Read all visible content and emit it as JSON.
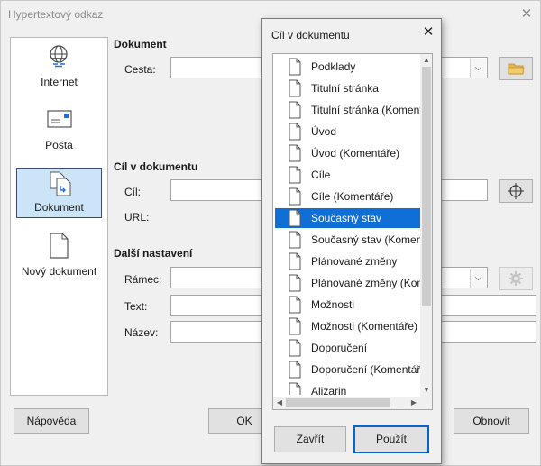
{
  "main": {
    "title": "Hypertextový odkaz",
    "close": "✕",
    "sidebar": {
      "items": [
        {
          "label": "Internet"
        },
        {
          "label": "Pošta"
        },
        {
          "label": "Dokument"
        },
        {
          "label": "Nový dokument"
        }
      ]
    },
    "document_section": {
      "heading": "Dokument",
      "path_label": "Cesta:",
      "path_value": ""
    },
    "target_section": {
      "heading": "Cíl v dokumentu",
      "target_label": "Cíl:",
      "target_value": "",
      "url_label": "URL:"
    },
    "other_section": {
      "heading": "Další nastavení",
      "frame_label": "Rámec:",
      "text_label": "Text:",
      "name_label": "Název:"
    },
    "buttons": {
      "help": "Nápověda",
      "ok": "OK",
      "reset": "Obnovit"
    }
  },
  "popup": {
    "title": "Cíl v dokumentu",
    "close": "✕",
    "items": [
      {
        "label": "Podklady"
      },
      {
        "label": "Titulní stránka"
      },
      {
        "label": "Titulní stránka (Komentáře)"
      },
      {
        "label": "Úvod"
      },
      {
        "label": "Úvod (Komentáře)"
      },
      {
        "label": "Cíle"
      },
      {
        "label": "Cíle (Komentáře)"
      },
      {
        "label": "Současný stav"
      },
      {
        "label": "Současný stav (Komentáře)"
      },
      {
        "label": "Plánované změny"
      },
      {
        "label": "Plánované změny (Komentáře)"
      },
      {
        "label": "Možnosti"
      },
      {
        "label": "Možnosti (Komentáře)"
      },
      {
        "label": "Doporučení"
      },
      {
        "label": "Doporučení (Komentáře)"
      },
      {
        "label": "Alizarin"
      }
    ],
    "selected_index": 7,
    "buttons": {
      "close": "Zavřít",
      "apply": "Použít"
    }
  },
  "colors": {
    "selection": "#0f6fd6",
    "active_sidebar": "#cce4f7",
    "primary_border": "#0a64c8"
  }
}
